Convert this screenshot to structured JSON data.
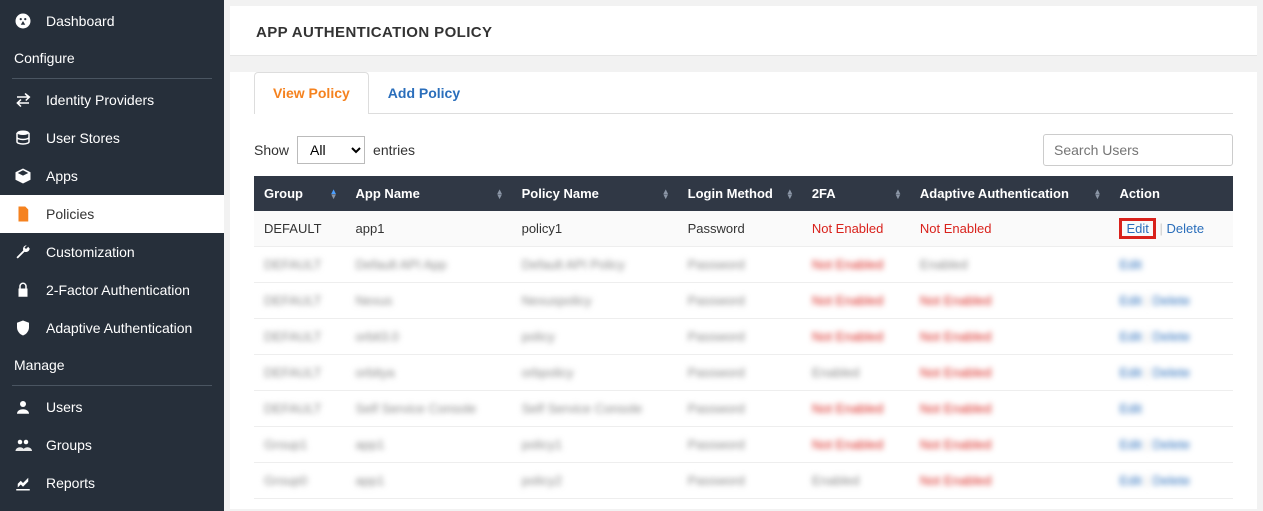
{
  "sidebar": {
    "top_items": [
      {
        "label": "Dashboard",
        "icon": "dashboard-icon"
      }
    ],
    "sections": [
      {
        "label": "Configure",
        "items": [
          {
            "label": "Identity Providers",
            "icon": "swap-icon"
          },
          {
            "label": "User Stores",
            "icon": "database-icon"
          },
          {
            "label": "Apps",
            "icon": "box-icon"
          },
          {
            "label": "Policies",
            "icon": "document-icon",
            "active": true
          },
          {
            "label": "Customization",
            "icon": "wrench-icon"
          },
          {
            "label": "2-Factor Authentication",
            "icon": "lock-icon"
          },
          {
            "label": "Adaptive Authentication",
            "icon": "shield-icon"
          }
        ]
      },
      {
        "label": "Manage",
        "items": [
          {
            "label": "Users",
            "icon": "user-icon"
          },
          {
            "label": "Groups",
            "icon": "groups-icon"
          },
          {
            "label": "Reports",
            "icon": "chart-icon"
          }
        ]
      }
    ]
  },
  "page": {
    "title": "APP AUTHENTICATION POLICY"
  },
  "tabs": [
    {
      "label": "View Policy",
      "active": true
    },
    {
      "label": "Add Policy",
      "active": false
    }
  ],
  "table": {
    "show_label": "Show",
    "entries_label": "entries",
    "select_value": "All",
    "search_placeholder": "Search Users",
    "headers": [
      "Group",
      "App Name",
      "Policy Name",
      "Login Method",
      "2FA",
      "Adaptive Authentication",
      "Action"
    ],
    "rows": [
      {
        "group": "DEFAULT",
        "app": "app1",
        "policy": "policy1",
        "login": "Password",
        "twofa": "Not Enabled",
        "adaptive": "Not Enabled",
        "actions": [
          "Edit",
          "Delete"
        ],
        "blur": false
      },
      {
        "group": "DEFAULT",
        "app": "Default API App",
        "policy": "Default API Policy",
        "login": "Password",
        "twofa": "Not Enabled",
        "adaptive": "Enabled",
        "actions": [
          "Edit"
        ],
        "blur": true
      },
      {
        "group": "DEFAULT",
        "app": "Nexus",
        "policy": "Nexuspolicy",
        "login": "Password",
        "twofa": "Not Enabled",
        "adaptive": "Not Enabled",
        "actions": [
          "Edit",
          "Delete"
        ],
        "blur": true
      },
      {
        "group": "DEFAULT",
        "app": "orbit3.0",
        "policy": "policy",
        "login": "Password",
        "twofa": "Not Enabled",
        "adaptive": "Not Enabled",
        "actions": [
          "Edit",
          "Delete"
        ],
        "blur": true
      },
      {
        "group": "DEFAULT",
        "app": "orbitya",
        "policy": "orbpolicy",
        "login": "Password",
        "twofa": "Enabled",
        "adaptive": "Not Enabled",
        "actions": [
          "Edit",
          "Delete"
        ],
        "blur": true
      },
      {
        "group": "DEFAULT",
        "app": "Self Service Console",
        "policy": "Self Service Console",
        "login": "Password",
        "twofa": "Not Enabled",
        "adaptive": "Not Enabled",
        "actions": [
          "Edit"
        ],
        "blur": true
      },
      {
        "group": "Group1",
        "app": "app1",
        "policy": "policy1",
        "login": "Password",
        "twofa": "Not Enabled",
        "adaptive": "Not Enabled",
        "actions": [
          "Edit",
          "Delete"
        ],
        "blur": true
      },
      {
        "group": "Group0",
        "app": "app1",
        "policy": "policy2",
        "login": "Password",
        "twofa": "Enabled",
        "adaptive": "Not Enabled",
        "actions": [
          "Edit",
          "Delete"
        ],
        "blur": true
      }
    ]
  }
}
